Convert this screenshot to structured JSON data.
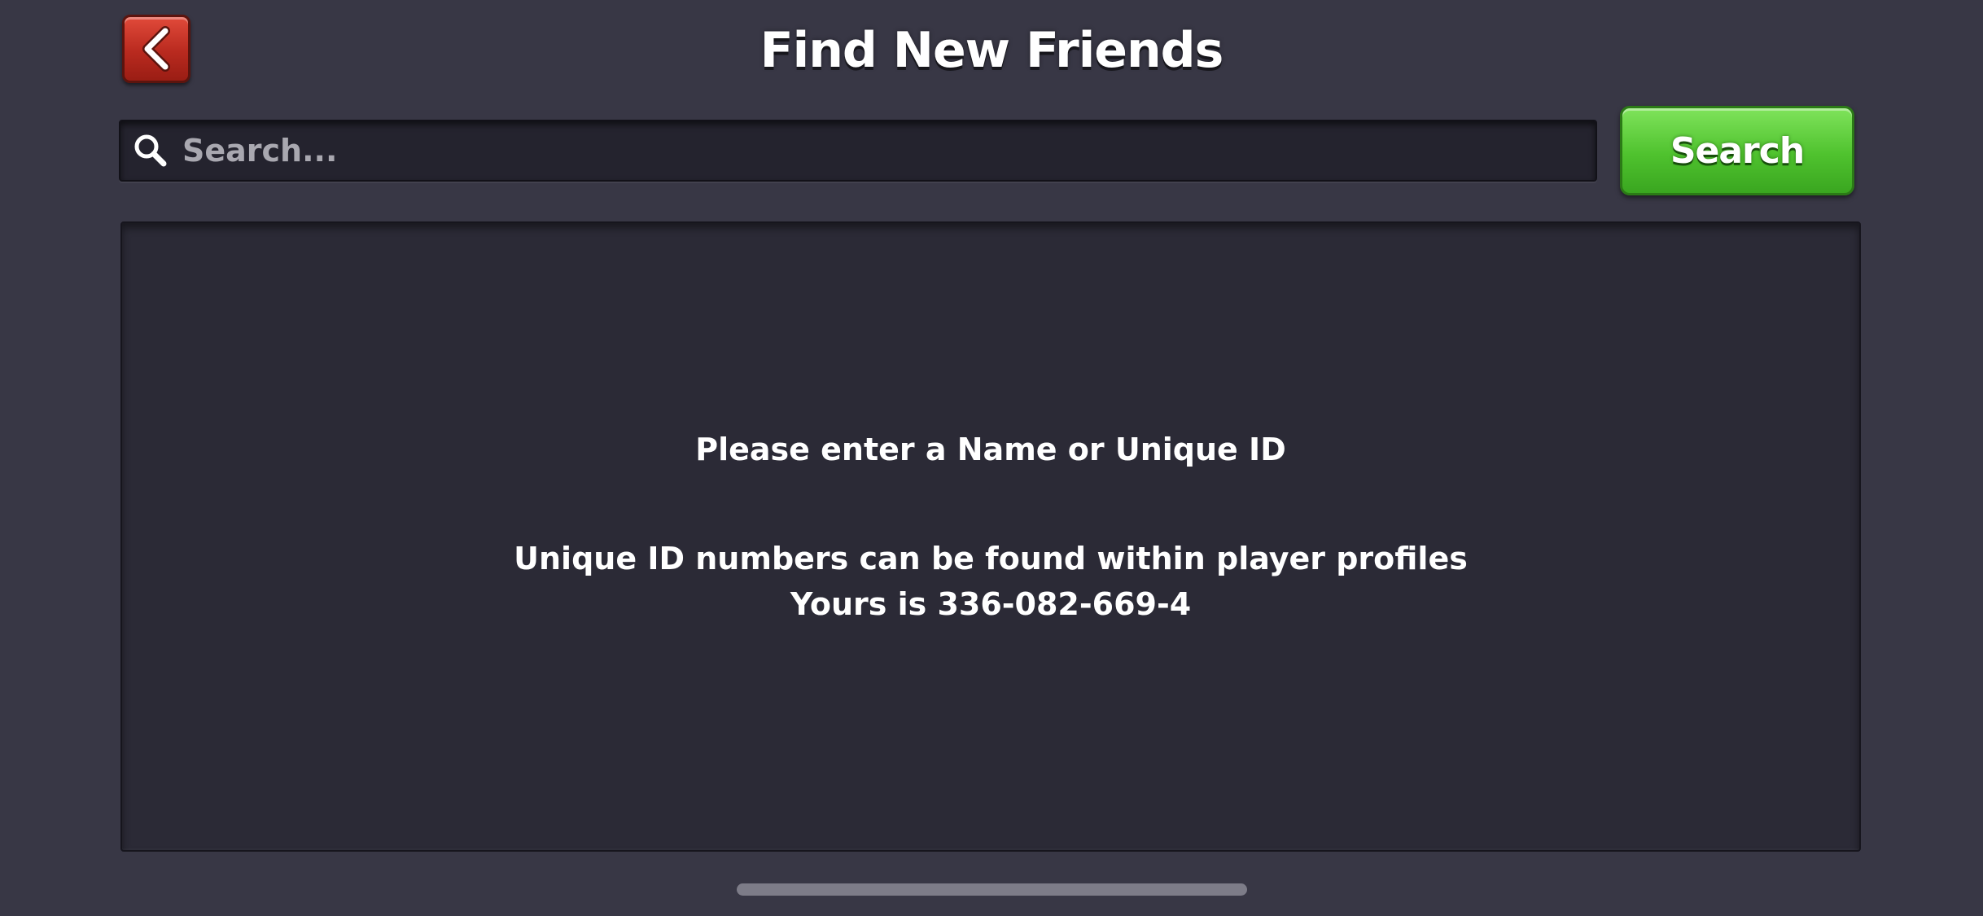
{
  "header": {
    "title": "Find New Friends",
    "back_icon": "chevron-left-icon"
  },
  "search": {
    "placeholder": "Search...",
    "value": "",
    "icon": "search-icon",
    "button_label": "Search"
  },
  "results_panel": {
    "prompt": "Please enter a Name or Unique ID",
    "hint": "Unique ID numbers can be found within player profiles",
    "your_id_line": "Yours is 336-082-669-4"
  },
  "colors": {
    "background": "#383745",
    "panel": "#2b2a36",
    "back_button": "#c0311f",
    "search_button": "#4fc22e",
    "text": "#ffffff",
    "placeholder": "#a9a8b0"
  }
}
